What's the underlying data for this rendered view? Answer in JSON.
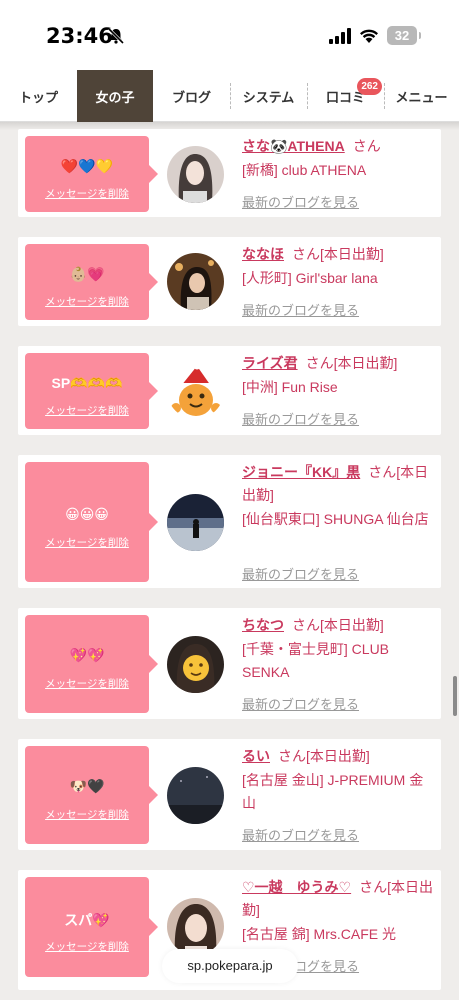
{
  "status": {
    "time": "23:46",
    "battery": "32"
  },
  "tabs": [
    {
      "label": "トップ",
      "active": false
    },
    {
      "label": "女の子",
      "active": true
    },
    {
      "label": "ブログ",
      "active": false
    },
    {
      "label": "システム",
      "active": false
    },
    {
      "label": "口コミ",
      "active": false,
      "badge": "262"
    },
    {
      "label": "メニュー",
      "active": false
    }
  ],
  "delete_label": "メッセージを削除",
  "blog_link_label": "最新のブログを見る",
  "honorific": "さん",
  "cards": [
    {
      "message": "❤️💙💛",
      "name": "さな🐼ATHENA",
      "status": "",
      "shop": "[新橋] club ATHENA",
      "avatar": "photo-woman"
    },
    {
      "message": "👶🏼💗",
      "name": "ななほ",
      "status": "[本日出勤]",
      "shop": "[人形町] Girl'sbar lana",
      "avatar": "photo-woman-bar"
    },
    {
      "message": "SP🫶🫶🫶",
      "name": "ライズ君",
      "status": "[本日出勤]",
      "shop": "[中洲] Fun Rise",
      "avatar": "mascot-santa"
    },
    {
      "message": "😀😀😀",
      "name": "ジョニー『KK』黒",
      "status": "[本日出勤]",
      "shop": "[仙台駅東口] SHUNGA 仙台店",
      "avatar": "photo-night-lake"
    },
    {
      "message": "💖💖",
      "name": "ちなつ",
      "status": "[本日出勤]",
      "shop": "[千葉・富士見町] CLUB SENKA",
      "avatar": "photo-emoji-face"
    },
    {
      "message": "🐶🖤",
      "name": "るい",
      "status": "[本日出勤]",
      "shop": "[名古屋 金山] J-PREMIUM 金山",
      "avatar": "photo-night-sky"
    },
    {
      "message": "スパ💖",
      "name": "♡一越　ゆうみ♡",
      "status": "[本日出勤]",
      "shop": "[名古屋 錦] Mrs.CAFE 光",
      "avatar": "photo-woman-2"
    }
  ],
  "url": "sp.pokepara.jp",
  "colors": {
    "accent": "#c9395e",
    "bubble": "#fb8c9d",
    "active_tab": "#4f4438",
    "badge": "#e9565c",
    "background": "#efedeb"
  }
}
